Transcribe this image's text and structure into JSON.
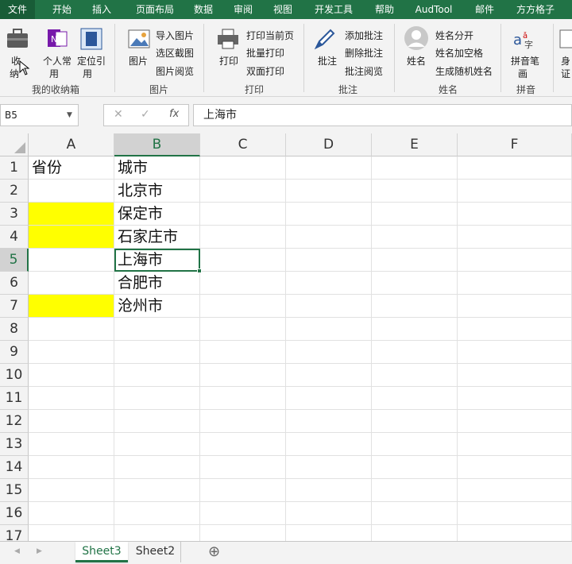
{
  "colors": {
    "brand": "#217346",
    "highlight": "#ffff00"
  },
  "tabs": [
    "文件",
    "开始",
    "插入",
    "页面布局",
    "数据",
    "审阅",
    "视图",
    "开发工具",
    "帮助",
    "AudTool",
    "邮件",
    "方方格子"
  ],
  "ribbon": {
    "collect": {
      "btn1a": "收",
      "btn1b": "纳",
      "btn2a": "个人常",
      "btn2b": "用",
      "btn3a": "定位引",
      "btn3b": "用",
      "group": "我的收纳箱"
    },
    "picture": {
      "big": "图片",
      "items": [
        "导入图片",
        "选区截图",
        "图片阅览"
      ],
      "group": "图片"
    },
    "print": {
      "big": "打印",
      "items": [
        "打印当前页",
        "批量打印",
        "双面打印"
      ],
      "group": "打印"
    },
    "comment": {
      "big": "批注",
      "items": [
        "添加批注",
        "删除批注",
        "批注阅览"
      ],
      "group": "批注"
    },
    "name": {
      "big": "姓名",
      "items": [
        "姓名分开",
        "姓名加空格",
        "生成随机姓名"
      ],
      "group": "姓名"
    },
    "pinyin": {
      "big1": "拼音笔",
      "big2": "画",
      "group": "拼音"
    },
    "more": {
      "a": "身",
      "b": "证"
    }
  },
  "formula_bar": {
    "name_box": "B5",
    "cancel": "✕",
    "enter": "✓",
    "fx": "fx",
    "value": "上海市"
  },
  "columns": [
    "A",
    "B",
    "C",
    "D",
    "E",
    "F"
  ],
  "rows": [
    "1",
    "2",
    "3",
    "4",
    "5",
    "6",
    "7",
    "8",
    "9",
    "10",
    "11",
    "12",
    "13",
    "14",
    "15",
    "16",
    "17"
  ],
  "cells": {
    "A1": "省份",
    "B1": "城市",
    "B2": "北京市",
    "B3": "保定市",
    "B4": "石家庄市",
    "B5": "上海市",
    "B6": "合肥市",
    "B7": "沧州市"
  },
  "sheets": [
    "Sheet3",
    "Sheet2"
  ],
  "sheet_nav": {
    "prev": "◀",
    "next": "▶",
    "add": "⊕"
  }
}
